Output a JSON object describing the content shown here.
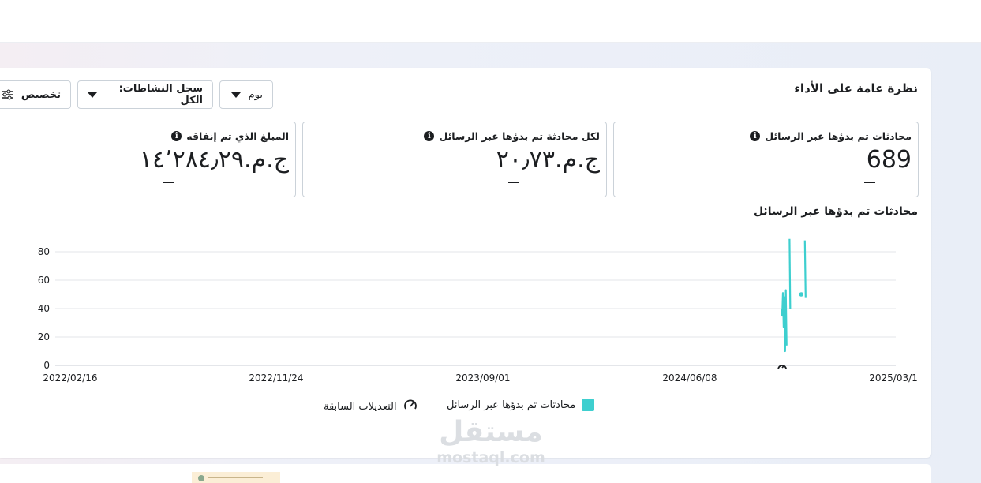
{
  "header": {
    "title": "نظرة عامة على الأداء"
  },
  "toolbar": {
    "period_label": "يوم",
    "activity_label": "سجل النشاطات: الكل",
    "customize_label": "تخصيص"
  },
  "cards": [
    {
      "label": "محادثات تم بدؤها عبر الرسائل",
      "value": "689",
      "delta": "—"
    },
    {
      "label": "لكل محادثة تم بدؤها عبر الرسائل",
      "value": "ج.م.‏٢٠٫٧٣",
      "delta": "—"
    },
    {
      "label": "المبلغ الذي تم إنفاقه",
      "value": "ج.م.‏١٤٬٢٨٤٫٢٩",
      "delta": "—"
    }
  ],
  "chart_title": "محادثات تم بدؤها عبر الرسائل",
  "legend": {
    "series_label": "محادثات تم بدؤها عبر الرسائل",
    "edits_label": "التعديلات السابقة"
  },
  "colors": {
    "series": "#3ecfcf",
    "text": "#1c1e21",
    "border": "#cbd2d9",
    "grid": "#e3e6ea"
  },
  "icons": [
    "info-icon",
    "caret-down-icon",
    "settings-sliders-icon",
    "edit-history-icon"
  ],
  "watermark": {
    "arabic": "مستقل",
    "latin": "mostaql.com"
  },
  "chart_data": {
    "type": "line",
    "title": "محادثات تم بدؤها عبر الرسائل",
    "x_tick_labels": [
      "2022/02/16",
      "2022/11/24",
      "2023/09/01",
      "2024/06/08",
      "2025/03/1"
    ],
    "xlim": [
      "2022/02/16",
      "2025/03/16"
    ],
    "ylim": [
      0,
      80
    ],
    "y_ticks": [
      0,
      20,
      40,
      60,
      80
    ],
    "grid": true,
    "legend_position": "bottom",
    "series": [
      {
        "name": "محادثات تم بدؤها عبر الرسائل",
        "points": [
          [
            "2024/10/14",
            40
          ],
          [
            "2024/10/15",
            35
          ],
          [
            "2024/10/16",
            51
          ],
          [
            "2024/10/17",
            27
          ],
          [
            "2024/10/18",
            48
          ],
          [
            "2024/10/19",
            10
          ],
          [
            "2024/10/20",
            53
          ],
          [
            "2024/10/21",
            14
          ],
          [
            "2024/10/25",
            89
          ],
          [
            "2024/10/26",
            40
          ],
          [
            "2024/11/10",
            50
          ],
          [
            "2024/11/15",
            88
          ],
          [
            "2024/11/16",
            48
          ]
        ]
      }
    ],
    "annotations": [
      {
        "type": "edit-marker",
        "x": "2024/10/15"
      }
    ]
  }
}
